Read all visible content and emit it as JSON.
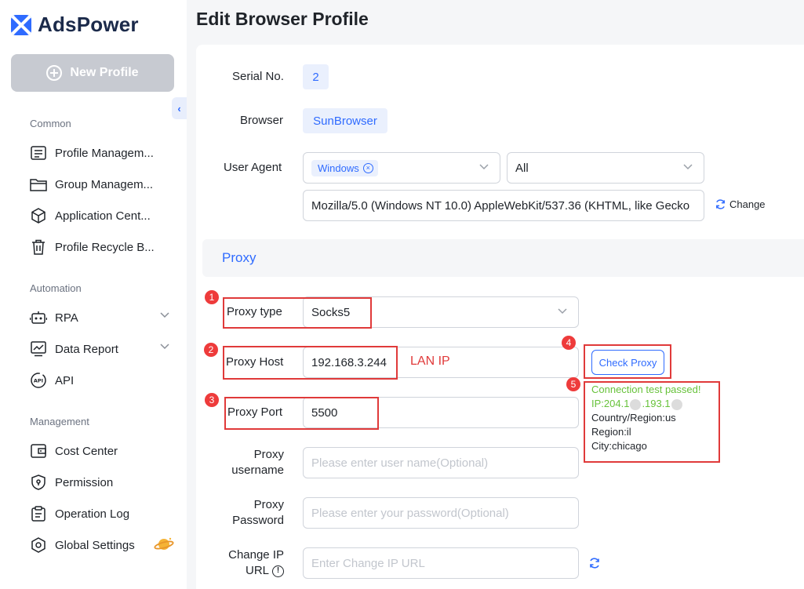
{
  "app": {
    "name": "AdsPower"
  },
  "sidebar": {
    "new_profile_label": "New Profile",
    "sections": {
      "common": "Common",
      "automation": "Automation",
      "management": "Management"
    },
    "items": {
      "profile_management": "Profile Managem...",
      "group_management": "Group Managem...",
      "application_center": "Application Cent...",
      "profile_recycle_bin": "Profile Recycle B...",
      "rpa": "RPA",
      "data_report": "Data Report",
      "api": "API",
      "cost_center": "Cost Center",
      "permission": "Permission",
      "operation_log": "Operation Log",
      "global_settings": "Global Settings"
    }
  },
  "page": {
    "title": "Edit Browser Profile"
  },
  "form": {
    "serial_no": {
      "label": "Serial No.",
      "value": "2"
    },
    "browser": {
      "label": "Browser",
      "value": "SunBrowser"
    },
    "user_agent": {
      "label": "User Agent",
      "os_tag": "Windows",
      "version_value": "All",
      "ua_string": "Mozilla/5.0 (Windows NT 10.0) AppleWebKit/537.36 (KHTML, like Gecko",
      "change_label": "Change"
    },
    "proxy_section_title": "Proxy",
    "proxy_type": {
      "label": "Proxy type",
      "value": "Socks5"
    },
    "proxy_host": {
      "label": "Proxy Host",
      "value": "192.168.3.244",
      "annotation": "LAN IP"
    },
    "proxy_port": {
      "label": "Proxy Port",
      "value": "5500"
    },
    "proxy_username": {
      "label_line1": "Proxy",
      "label_line2": "username",
      "placeholder": "Please enter user name(Optional)"
    },
    "proxy_password": {
      "label_line1": "Proxy",
      "label_line2": "Password",
      "placeholder": "Please enter your password(Optional)"
    },
    "change_ip_url": {
      "label_line1": "Change IP",
      "label_line2": "URL",
      "placeholder": "Enter Change IP URL"
    },
    "check_proxy_label": "Check Proxy",
    "result": {
      "status": "Connection test passed!",
      "ip_prefix": "IP:204.1",
      "ip_mid": ".193.1",
      "country": "Country/Region:us",
      "region": "Region:il",
      "city": "City:chicago"
    }
  },
  "annotations": {
    "badges": [
      "1",
      "2",
      "3",
      "4",
      "5"
    ]
  },
  "colors": {
    "accent": "#2f6bff",
    "annotation_red": "#e03a3a",
    "success": "#67c23a"
  }
}
